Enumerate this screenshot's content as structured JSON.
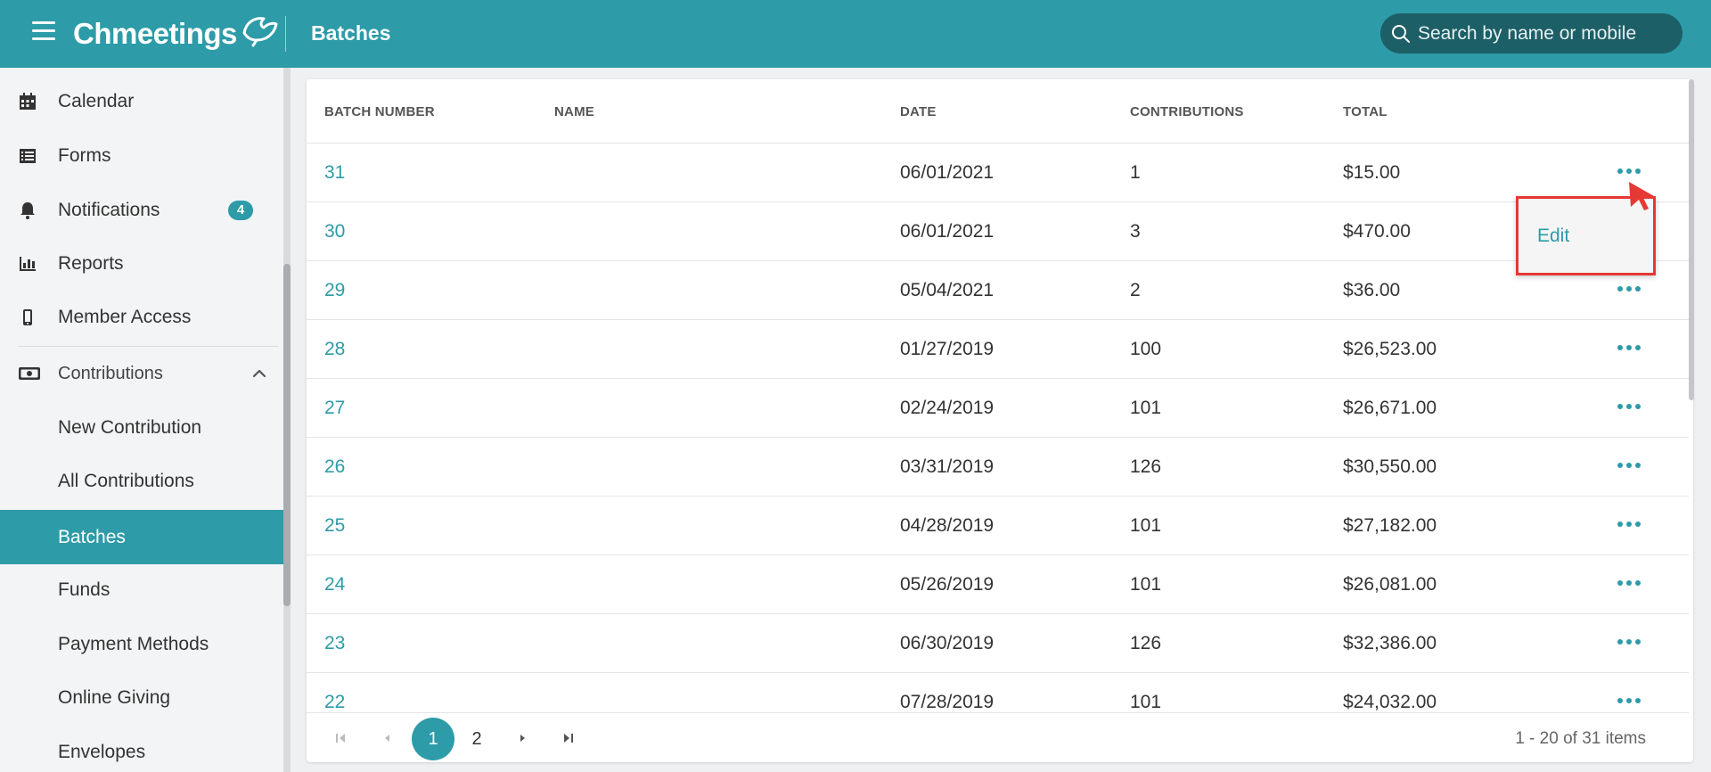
{
  "header": {
    "brand": "Chmeetings",
    "page_title": "Batches",
    "search_placeholder": "Search by name or mobile"
  },
  "sidebar": {
    "items": [
      {
        "label": "Calendar",
        "icon": "calendar-icon"
      },
      {
        "label": "Forms",
        "icon": "list-icon"
      },
      {
        "label": "Notifications",
        "icon": "bell-icon",
        "badge": "4"
      },
      {
        "label": "Reports",
        "icon": "bar-chart-icon"
      },
      {
        "label": "Member Access",
        "icon": "mobile-icon"
      }
    ],
    "section": {
      "label": "Contributions",
      "icon": "money-icon"
    },
    "sub_items": [
      {
        "label": "New Contribution"
      },
      {
        "label": "All Contributions"
      },
      {
        "label": "Batches",
        "active": true
      },
      {
        "label": "Funds"
      },
      {
        "label": "Payment Methods"
      },
      {
        "label": "Online Giving"
      },
      {
        "label": "Envelopes"
      }
    ]
  },
  "table": {
    "columns": [
      "BATCH NUMBER",
      "NAME",
      "DATE",
      "CONTRIBUTIONS",
      "TOTAL"
    ],
    "rows": [
      {
        "batch": "31",
        "name": "",
        "date": "06/01/2021",
        "contributions": "1",
        "total": "$15.00"
      },
      {
        "batch": "30",
        "name": "",
        "date": "06/01/2021",
        "contributions": "3",
        "total": "$470.00"
      },
      {
        "batch": "29",
        "name": "",
        "date": "05/04/2021",
        "contributions": "2",
        "total": "$36.00"
      },
      {
        "batch": "28",
        "name": "",
        "date": "01/27/2019",
        "contributions": "100",
        "total": "$26,523.00"
      },
      {
        "batch": "27",
        "name": "",
        "date": "02/24/2019",
        "contributions": "101",
        "total": "$26,671.00"
      },
      {
        "batch": "26",
        "name": "",
        "date": "03/31/2019",
        "contributions": "126",
        "total": "$30,550.00"
      },
      {
        "batch": "25",
        "name": "",
        "date": "04/28/2019",
        "contributions": "101",
        "total": "$27,182.00"
      },
      {
        "batch": "24",
        "name": "",
        "date": "05/26/2019",
        "contributions": "101",
        "total": "$26,081.00"
      },
      {
        "batch": "23",
        "name": "",
        "date": "06/30/2019",
        "contributions": "126",
        "total": "$32,386.00"
      },
      {
        "batch": "22",
        "name": "",
        "date": "07/28/2019",
        "contributions": "101",
        "total": "$24,032.00"
      }
    ]
  },
  "row_menu": {
    "edit_label": "Edit"
  },
  "pager": {
    "pages": [
      "1",
      "2"
    ],
    "current": "1",
    "info": "1 - 20 of 31 items"
  },
  "colors": {
    "accent": "#2d9ba8",
    "highlight": "#e53935"
  }
}
